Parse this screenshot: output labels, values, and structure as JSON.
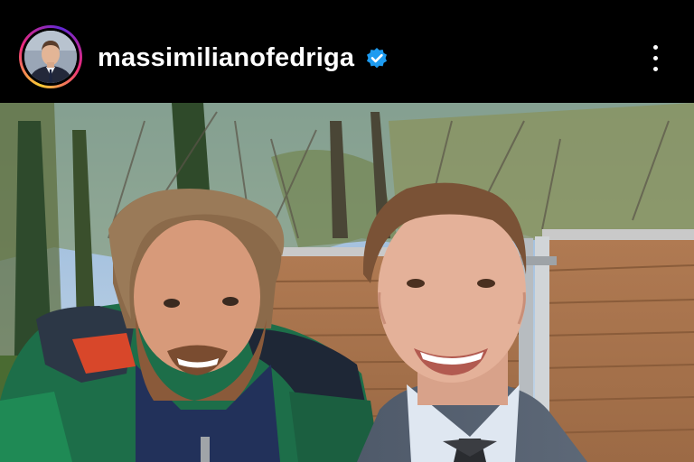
{
  "post": {
    "username": "massimilianofedriga",
    "verified": true,
    "avatar_icon": "profile-avatar",
    "verified_icon": "verified-badge-icon",
    "more_icon": "more-options-icon"
  },
  "colors": {
    "header_bg": "#000000",
    "verified_blue": "#1d9bf0",
    "text": "#ffffff"
  }
}
